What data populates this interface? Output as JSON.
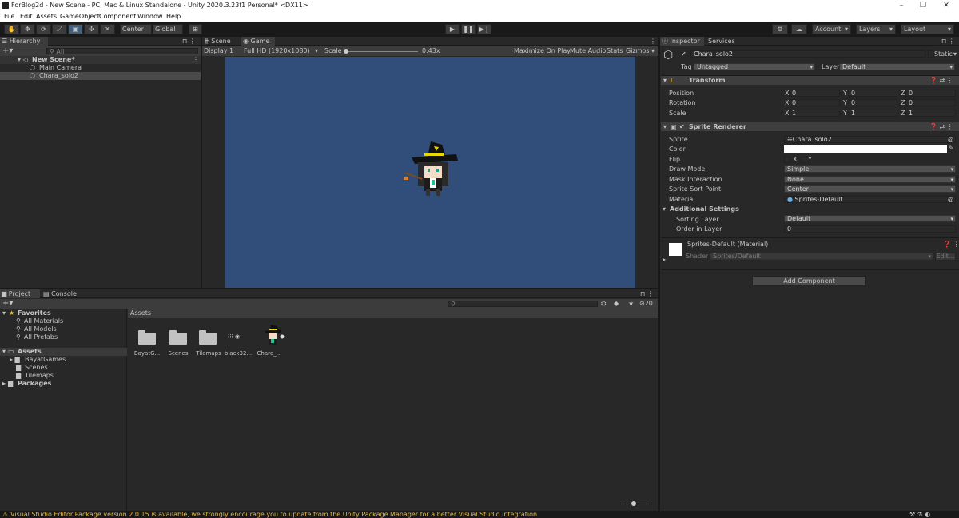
{
  "window": {
    "title": "ForBlog2d - New Scene - PC, Mac & Linux Standalone - Unity 2020.3.23f1 Personal* <DX11>",
    "minimize": "–",
    "maximize": "❐",
    "close": "✕"
  },
  "menu": [
    "File",
    "Edit",
    "Assets",
    "GameObject",
    "Component",
    "Window",
    "Help"
  ],
  "toolbar": {
    "pivot": "Center",
    "space": "Global",
    "account": "Account",
    "layers": "Layers",
    "layout": "Layout"
  },
  "hierarchy": {
    "tab": "Hierarchy",
    "search_placeholder": "All",
    "scene": "New Scene*",
    "items": [
      "Main Camera",
      "Chara_solo2"
    ]
  },
  "game_view": {
    "tab_scene": "Scene",
    "tab_game": "Game",
    "display": "Display 1",
    "resolution": "Full HD (1920x1080)",
    "scale_label": "Scale",
    "scale_value": "0.43x",
    "maximize": "Maximize On Play",
    "mute": "Mute Audio",
    "stats": "Stats",
    "gizmos": "Gizmos",
    "background_color": "#314d79"
  },
  "inspector": {
    "tab": "Inspector",
    "tab_services": "Services",
    "object_name": "Chara_solo2",
    "static_label": "Static",
    "tag_label": "Tag",
    "tag_value": "Untagged",
    "layer_label": "Layer",
    "layer_value": "Default",
    "transform": {
      "title": "Transform",
      "position_label": "Position",
      "rotation_label": "Rotation",
      "scale_label": "Scale",
      "position": [
        "0",
        "0",
        "0"
      ],
      "rotation": [
        "0",
        "0",
        "0"
      ],
      "scale": [
        "1",
        "1",
        "1"
      ]
    },
    "sprite_renderer": {
      "title": "Sprite Renderer",
      "sprite_label": "Sprite",
      "sprite_value": "Chara_solo2",
      "color_label": "Color",
      "flip_label": "Flip",
      "flip_x": "X",
      "flip_y": "Y",
      "draw_mode_label": "Draw Mode",
      "draw_mode": "Simple",
      "mask_label": "Mask Interaction",
      "mask": "None",
      "sort_point_label": "Sprite Sort Point",
      "sort_point": "Center",
      "material_label": "Material",
      "material": "Sprites-Default",
      "additional": "Additional Settings",
      "sorting_layer_label": "Sorting Layer",
      "sorting_layer": "Default",
      "order_label": "Order in Layer",
      "order": "0"
    },
    "material": {
      "title": "Sprites-Default (Material)",
      "shader_label": "Shader",
      "shader": "Sprites/Default",
      "edit": "Edit..."
    },
    "add_component": "Add Component"
  },
  "project": {
    "tab": "Project",
    "tab_console": "Console",
    "favorites": "Favorites",
    "favorite_items": [
      "All Materials",
      "All Models",
      "All Prefabs"
    ],
    "assets_root": "Assets",
    "asset_folders": [
      "BayatGames",
      "Scenes",
      "Tilemaps"
    ],
    "packages": "Packages",
    "breadcrumb": "Assets",
    "hidden_count": "20",
    "asset_items": [
      "BayatG...",
      "Scenes",
      "Tilemaps",
      "black32...",
      "Chara_..."
    ]
  },
  "status_message": "Visual Studio Editor Package version 2.0.15 is available, we strongly encourage you to update from the Unity Package Manager for a better Visual Studio integration"
}
